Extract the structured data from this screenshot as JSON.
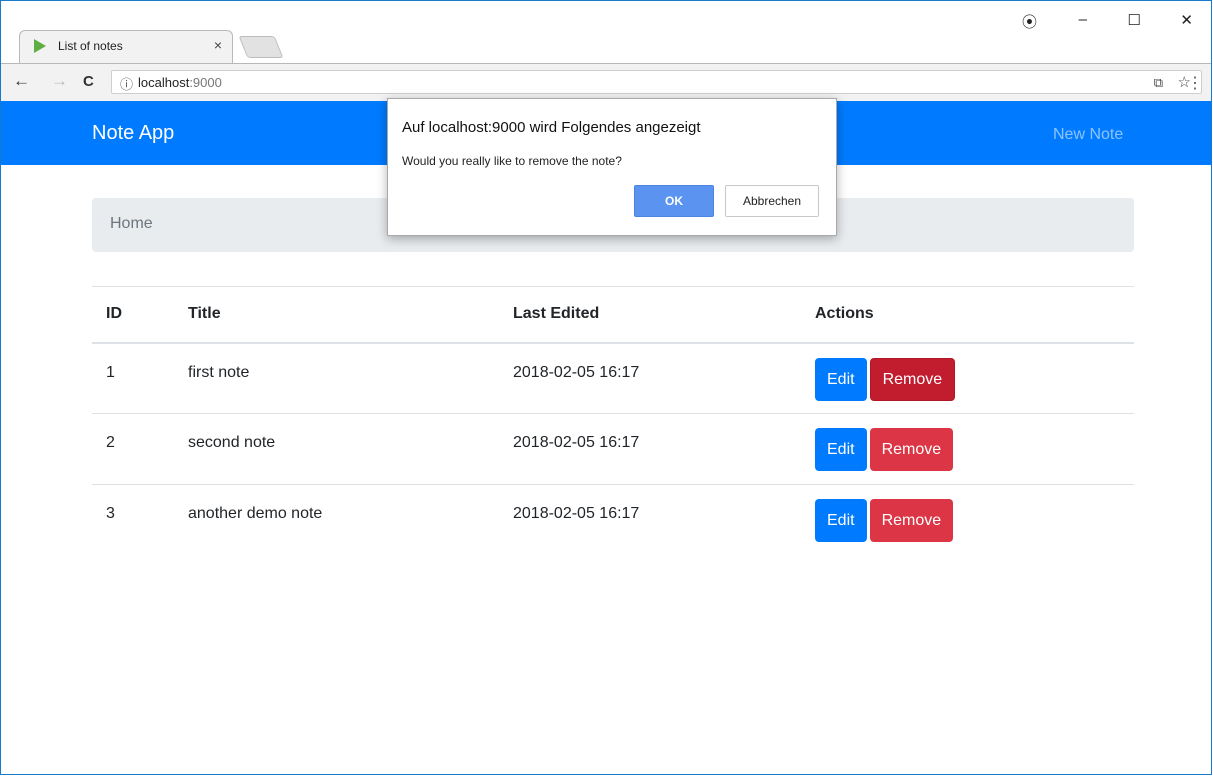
{
  "browser": {
    "tab_title": "List of notes",
    "tab_close": "×",
    "url_host": "localhost",
    "url_port": ":9000",
    "window_controls": {
      "account": "⦿",
      "minimize": "–",
      "maximize": "☐",
      "close": "✕"
    },
    "nav": {
      "back": "←",
      "forward": "→",
      "reload": "C"
    },
    "info_icon": "ⓘ",
    "translate_icon": "⧉",
    "star_icon": "☆",
    "menu_icon": "⋮"
  },
  "navbar": {
    "brand": "Note App",
    "new_note": "New Note"
  },
  "breadcrumb": {
    "home": "Home"
  },
  "table": {
    "headers": [
      "ID",
      "Title",
      "Last Edited",
      "Actions"
    ],
    "rows": [
      {
        "id": "1",
        "title": "first note",
        "edited": "2018-02-05 16:17"
      },
      {
        "id": "2",
        "title": "second note",
        "edited": "2018-02-05 16:17"
      },
      {
        "id": "3",
        "title": "another demo note",
        "edited": "2018-02-05 16:17"
      }
    ],
    "edit_label": "Edit",
    "remove_label": "Remove"
  },
  "dialog": {
    "title": "Auf localhost:9000 wird Folgendes angezeigt",
    "message": "Would you really like to remove the note?",
    "ok": "OK",
    "cancel": "Abbrechen"
  },
  "colors": {
    "primary": "#007bff",
    "danger": "#dc3545",
    "danger_active": "#c21d2f",
    "dialog_ok": "#5a94f0"
  }
}
